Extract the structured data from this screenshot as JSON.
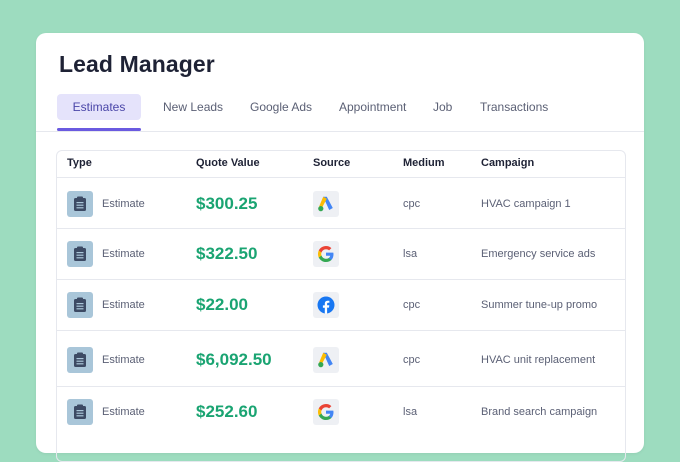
{
  "app": {
    "title": "Lead Manager"
  },
  "tabs": [
    {
      "label": "Estimates",
      "active": true
    },
    {
      "label": "New Leads"
    },
    {
      "label": "Google Ads"
    },
    {
      "label": "Appointment"
    },
    {
      "label": "Job"
    },
    {
      "label": "Transactions"
    }
  ],
  "table": {
    "columns": [
      "Type",
      "Quote Value",
      "Source",
      "Medium",
      "Campaign"
    ],
    "rows": [
      {
        "type": "Estimate",
        "type_icon": "clipboard-icon",
        "value": "$300.25",
        "source": "google-ads-icon",
        "medium": "cpc",
        "campaign": "HVAC campaign 1"
      },
      {
        "type": "Estimate",
        "type_icon": "clipboard-icon",
        "value": "$322.50",
        "source": "google-icon",
        "medium": "lsa",
        "campaign": "Emergency service ads"
      },
      {
        "type": "Estimate",
        "type_icon": "clipboard-icon",
        "value": "$22.00",
        "source": "facebook-icon",
        "medium": "cpc",
        "campaign": "Summer tune-up promo"
      },
      {
        "type": "Estimate",
        "type_icon": "clipboard-icon",
        "value": "$6,092.50",
        "source": "google-ads-icon",
        "medium": "cpc",
        "campaign": "HVAC unit replacement"
      },
      {
        "type": "Estimate",
        "type_icon": "clipboard-icon",
        "value": "$252.60",
        "source": "google-icon",
        "medium": "lsa",
        "campaign": "Brand search campaign"
      }
    ]
  },
  "colors": {
    "background": "#9ddcbf",
    "accent": "#6a5ae0",
    "active_tab_bg": "#e5e3fb",
    "value_green": "#1aa472",
    "type_icon_bg": "#a9c6d9"
  }
}
